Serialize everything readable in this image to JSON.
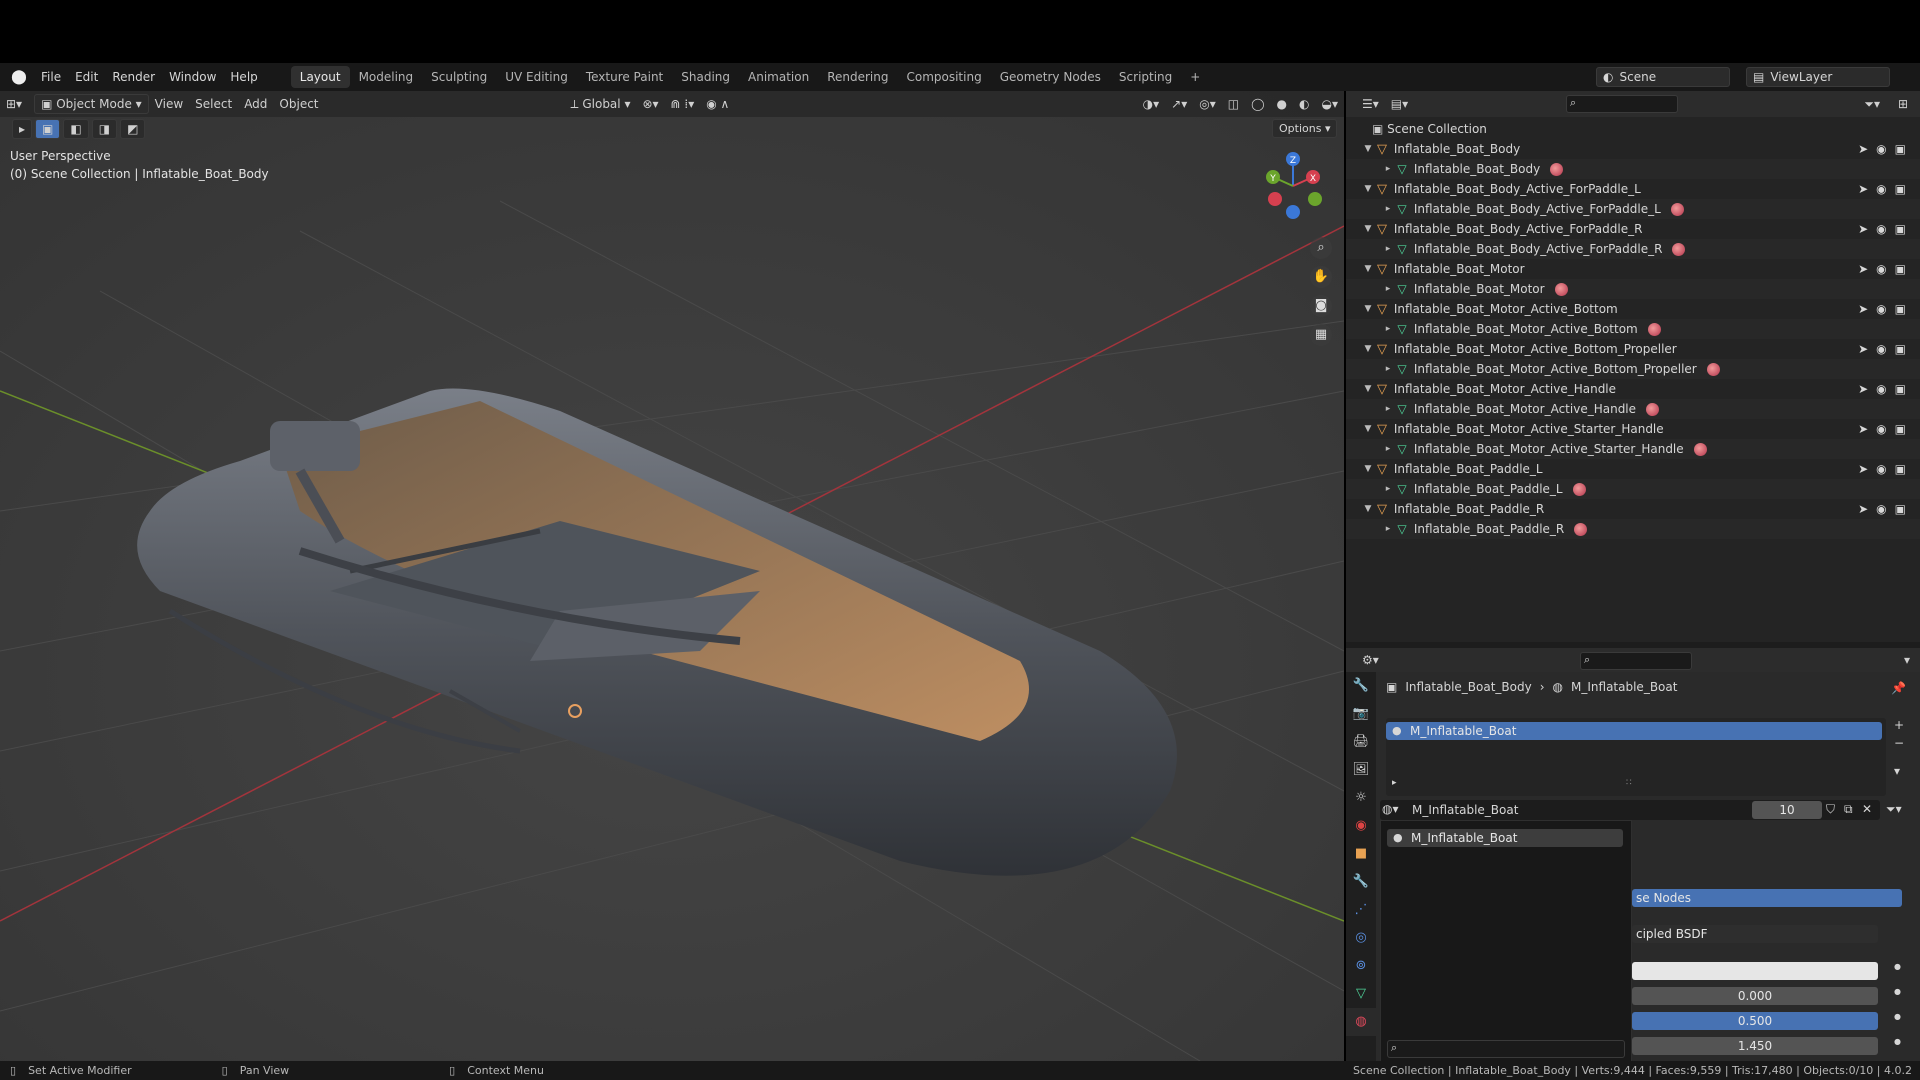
{
  "menubar": {
    "items": [
      "File",
      "Edit",
      "Render",
      "Window",
      "Help"
    ],
    "workspaces": [
      "Layout",
      "Modeling",
      "Sculpting",
      "UV Editing",
      "Texture Paint",
      "Shading",
      "Animation",
      "Rendering",
      "Compositing",
      "Geometry Nodes",
      "Scripting"
    ],
    "active_workspace": "Layout",
    "add_tab": "+",
    "scene_label": "Scene",
    "viewlayer_label": "ViewLayer"
  },
  "viewport": {
    "mode": "Object Mode",
    "menus": [
      "View",
      "Select",
      "Add",
      "Object"
    ],
    "transform_orientation": "Global",
    "options_label": "Options",
    "perspective_label": "User Perspective",
    "collection_label": "(0) Scene Collection | Inflatable_Boat_Body",
    "gizmo_axes": {
      "x": "X",
      "y": "Y",
      "z": "Z"
    }
  },
  "outliner": {
    "root": "Scene Collection",
    "items": [
      {
        "object": "Inflatable_Boat_Body",
        "mesh": "Inflatable_Boat_Body"
      },
      {
        "object": "Inflatable_Boat_Body_Active_ForPaddle_L",
        "mesh": "Inflatable_Boat_Body_Active_ForPaddle_L"
      },
      {
        "object": "Inflatable_Boat_Body_Active_ForPaddle_R",
        "mesh": "Inflatable_Boat_Body_Active_ForPaddle_R"
      },
      {
        "object": "Inflatable_Boat_Motor",
        "mesh": "Inflatable_Boat_Motor"
      },
      {
        "object": "Inflatable_Boat_Motor_Active_Bottom",
        "mesh": "Inflatable_Boat_Motor_Active_Bottom"
      },
      {
        "object": "Inflatable_Boat_Motor_Active_Bottom_Propeller",
        "mesh": "Inflatable_Boat_Motor_Active_Bottom_Propeller"
      },
      {
        "object": "Inflatable_Boat_Motor_Active_Handle",
        "mesh": "Inflatable_Boat_Motor_Active_Handle"
      },
      {
        "object": "Inflatable_Boat_Motor_Active_Starter_Handle",
        "mesh": "Inflatable_Boat_Motor_Active_Starter_Handle"
      },
      {
        "object": "Inflatable_Boat_Paddle_L",
        "mesh": "Inflatable_Boat_Paddle_L"
      },
      {
        "object": "Inflatable_Boat_Paddle_R",
        "mesh": "Inflatable_Boat_Paddle_R"
      }
    ]
  },
  "properties": {
    "breadcrumb_object": "Inflatable_Boat_Body",
    "breadcrumb_material": "M_Inflatable_Boat",
    "slot_item": "M_Inflatable_Boat",
    "material_name": "M_Inflatable_Boat",
    "user_count": "10",
    "dropdown_item": "M_Inflatable_Boat",
    "use_nodes_label": "se Nodes",
    "surface_label": "cipled BSDF",
    "values": [
      "0.000",
      "0.500",
      "1.450"
    ]
  },
  "statusbar": {
    "left1": "Set Active Modifier",
    "left2": "Pan View",
    "left3": "Context Menu",
    "right": "Scene Collection | Inflatable_Boat_Body | Verts:9,444 | Faces:9,559 | Tris:17,480 | Objects:0/10 | 4.0.2"
  },
  "colors": {
    "accent": "#4772b3",
    "object_icon": "#e8a253",
    "mesh_icon": "#4fd49a",
    "boat_body": "#5a5f68",
    "floor": "#b48558"
  }
}
